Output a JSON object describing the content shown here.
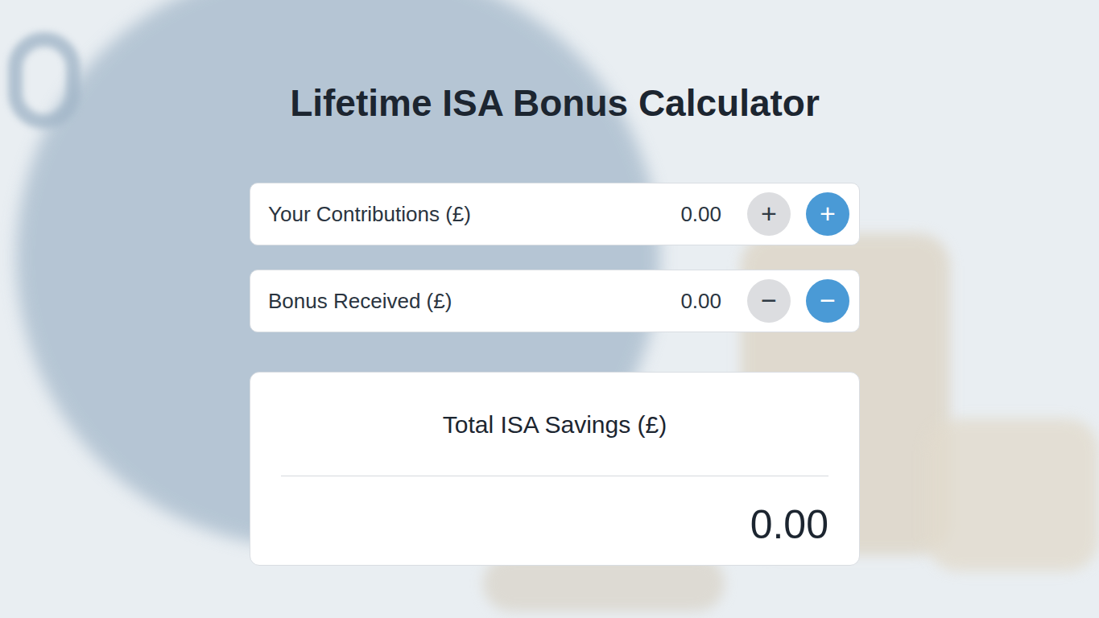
{
  "title": "Lifetime ISA Bonus Calculator",
  "fields": [
    {
      "label": "Your Contributions (£)",
      "value": "0.00",
      "buttons": [
        {
          "symbol": "+",
          "kind": "plain"
        },
        {
          "symbol": "+",
          "kind": "filled"
        }
      ]
    },
    {
      "label": "Bonus Received (£)",
      "value": "0.00",
      "buttons": [
        {
          "symbol": "−",
          "kind": "plain"
        },
        {
          "symbol": "−",
          "kind": "filled"
        }
      ]
    }
  ],
  "total": {
    "label": "Total ISA Savings (£)",
    "value": "0.00"
  }
}
